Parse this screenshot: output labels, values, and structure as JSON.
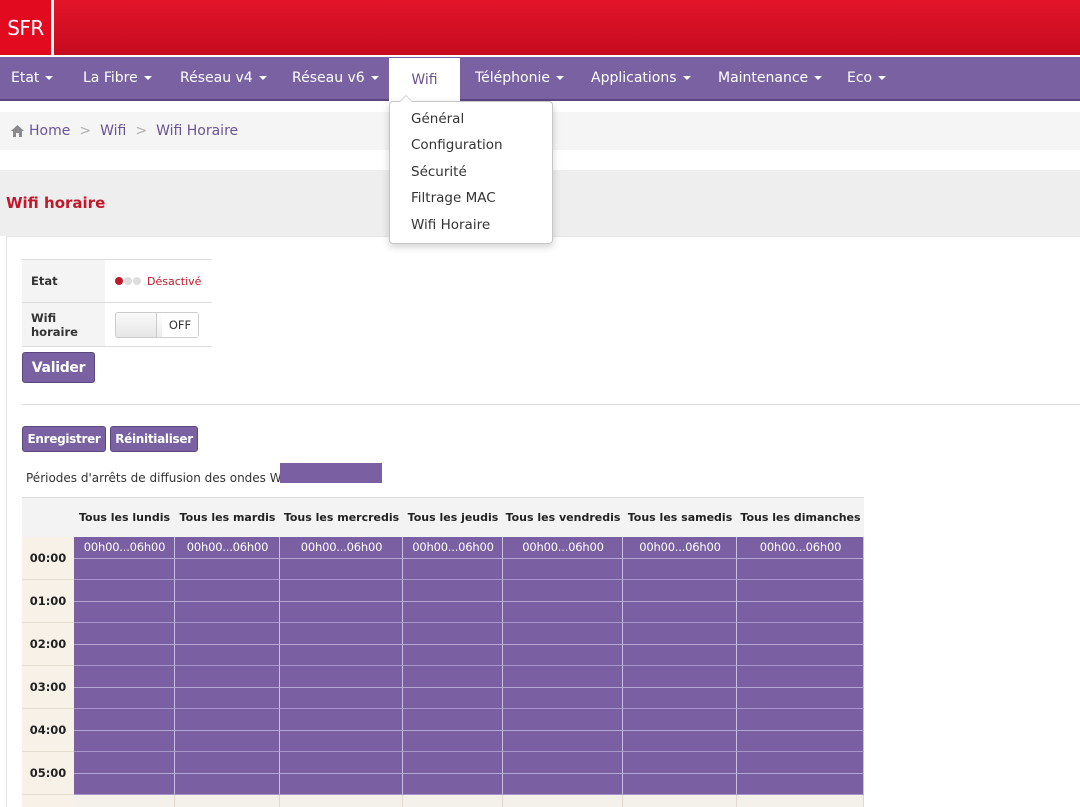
{
  "brand": {
    "logo_text": "SFR",
    "primary_color": "#e20a1e",
    "accent_color": "#7a62a2"
  },
  "nav": {
    "items": [
      {
        "label": "Etat",
        "has_caret": true
      },
      {
        "label": "La Fibre",
        "has_caret": true
      },
      {
        "label": "Réseau v4",
        "has_caret": true
      },
      {
        "label": "Réseau v6",
        "has_caret": true
      },
      {
        "label": "Wifi",
        "has_caret": false,
        "active": true
      },
      {
        "label": "Téléphonie",
        "has_caret": true
      },
      {
        "label": "Applications",
        "has_caret": true
      },
      {
        "label": "Maintenance",
        "has_caret": true
      },
      {
        "label": "Eco",
        "has_caret": true
      }
    ],
    "dropdown": [
      "Général",
      "Configuration",
      "Sécurité",
      "Filtrage MAC",
      "Wifi Horaire"
    ]
  },
  "breadcrumb": {
    "home": "Home",
    "level1": "Wifi",
    "level2": "Wifi Horaire",
    "separator": ">"
  },
  "page": {
    "title": "Wifi horaire"
  },
  "form": {
    "etat_label": "Etat",
    "etat_value": "Désactivé",
    "wifi_label": "Wifi horaire",
    "toggle_value": "OFF",
    "valider": "Valider"
  },
  "schedule": {
    "enregistrer": "Enregistrer",
    "reinitialiser": "Réinitialiser",
    "legend_text": "Périodes d'arrêts de diffusion des ondes Wifi.",
    "days": [
      "Tous les lundis",
      "Tous les mardis",
      "Tous les mercredis",
      "Tous les jeudis",
      "Tous les vendredis",
      "Tous les samedis",
      "Tous les dimanches"
    ],
    "hours": [
      "00:00",
      "01:00",
      "02:00",
      "03:00",
      "04:00",
      "05:00"
    ],
    "period_label": "00h00...06h00",
    "period_color": "#7a5fa3"
  }
}
